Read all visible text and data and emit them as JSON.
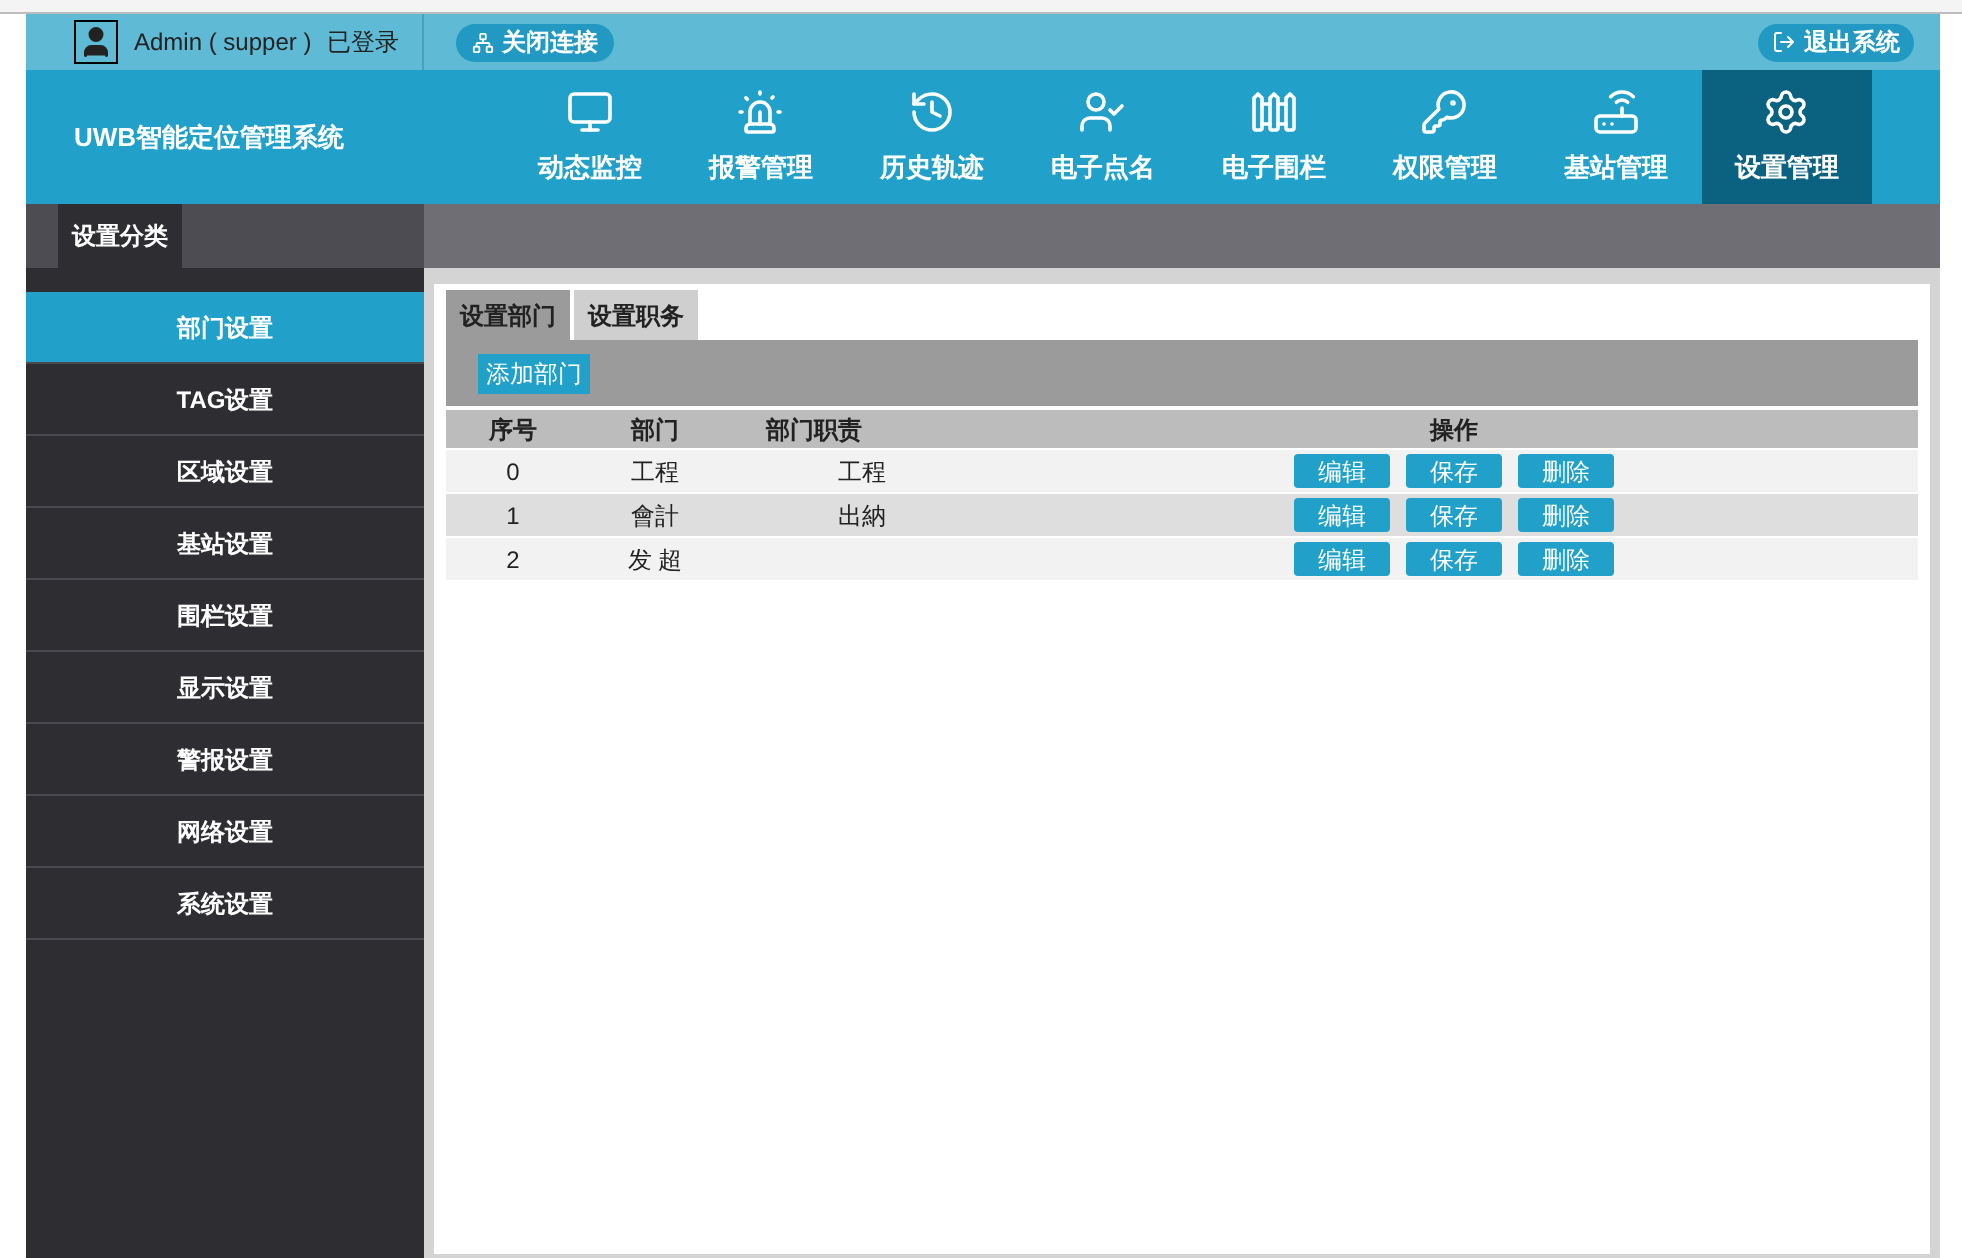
{
  "user": {
    "name": "Admin ( supper )",
    "status": "已登录"
  },
  "connection_button": "关闭连接",
  "logout_button": "退出系统",
  "app_title": "UWB智能定位管理系统",
  "nav": [
    {
      "label": "动态监控",
      "selected": false
    },
    {
      "label": "报警管理",
      "selected": false
    },
    {
      "label": "历史轨迹",
      "selected": false
    },
    {
      "label": "电子点名",
      "selected": false
    },
    {
      "label": "电子围栏",
      "selected": false
    },
    {
      "label": "权限管理",
      "selected": false
    },
    {
      "label": "基站管理",
      "selected": false
    },
    {
      "label": "设置管理",
      "selected": true
    }
  ],
  "sidebar": {
    "title": "设置分类",
    "items": [
      {
        "label": "部门设置",
        "selected": true
      },
      {
        "label": "TAG设置",
        "selected": false
      },
      {
        "label": "区域设置",
        "selected": false
      },
      {
        "label": "基站设置",
        "selected": false
      },
      {
        "label": "围栏设置",
        "selected": false
      },
      {
        "label": "显示设置",
        "selected": false
      },
      {
        "label": "警报设置",
        "selected": false
      },
      {
        "label": "网络设置",
        "selected": false
      },
      {
        "label": "系统设置",
        "selected": false
      }
    ]
  },
  "tabs": [
    {
      "label": "设置部门",
      "selected": true
    },
    {
      "label": "设置职务",
      "selected": false
    }
  ],
  "add_button": "添加部门",
  "table": {
    "columns": [
      "序号",
      "部门",
      "部门职责",
      "操作"
    ],
    "rows": [
      {
        "cells": [
          "0",
          "工程",
          "工程"
        ],
        "actions": [
          "编辑",
          "保存",
          "删除"
        ]
      },
      {
        "cells": [
          "1",
          "會計",
          "出納"
        ],
        "actions": [
          "编辑",
          "保存",
          "删除"
        ]
      },
      {
        "cells": [
          "2",
          "发 超",
          ""
        ],
        "actions": [
          "编辑",
          "保存",
          "删除"
        ]
      }
    ]
  }
}
